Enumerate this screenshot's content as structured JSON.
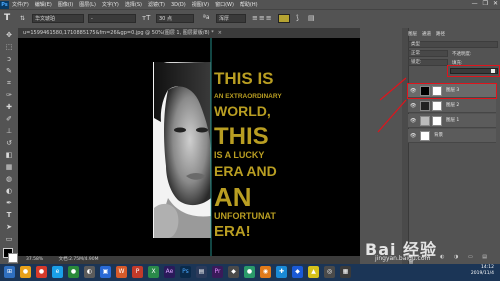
{
  "menubar": {
    "logo": "Ps",
    "items": [
      "文件(F)",
      "编辑(E)",
      "图像(I)",
      "图层(L)",
      "文字(Y)",
      "选择(S)",
      "滤镜(T)",
      "3D(D)",
      "视图(V)",
      "窗口(W)",
      "帮助(H)"
    ],
    "window_controls": [
      "—",
      "❐",
      "✕"
    ]
  },
  "options": {
    "tool_glyph": "T",
    "font_family": "华文琥珀",
    "font_style": "-",
    "font_size": "30 点",
    "aa_mode": "浑厚",
    "text_color": "#b5a332"
  },
  "document": {
    "tab_title": "u=1599461580,1710885175&fm=26&gp=0.jpg @ 50%(图层 1, 图层蒙版/8) *",
    "tab_close": "×",
    "zoom": "37.58%",
    "doc_info": "文档:2.75M/4.90M",
    "poster_lines": [
      "THIS IS",
      "AN EXTRAORDINARY",
      "WORLD,",
      "THIS",
      "IS A LUCKY",
      "ERA AND",
      "AN",
      "UNFORTUNAT",
      "ERA!"
    ]
  },
  "panels": {
    "tabs": [
      "图层",
      "通道",
      "路径"
    ],
    "kind_filter": "类型",
    "blend_mode": "正常",
    "opacity_label": "不透明度:",
    "lock_label": "锁定:",
    "fill_label": "填充:",
    "layers": [
      {
        "name": "图层 3",
        "selected": true
      },
      {
        "name": "图层 2",
        "selected": false
      },
      {
        "name": "图层 1",
        "selected": false
      },
      {
        "name": "背景",
        "selected": false
      }
    ],
    "bottom_icons": "⊖ fx ◐ ◑ ▭ ▤ 🗑"
  },
  "taskbar": {
    "time": "14:12",
    "date": "2019/11/4"
  },
  "watermark": {
    "brand": "Bai 经验",
    "url": "jingyan.baidu.com"
  },
  "colors": {
    "accent_text": "#b99e22",
    "annotation": "#e0141c"
  }
}
